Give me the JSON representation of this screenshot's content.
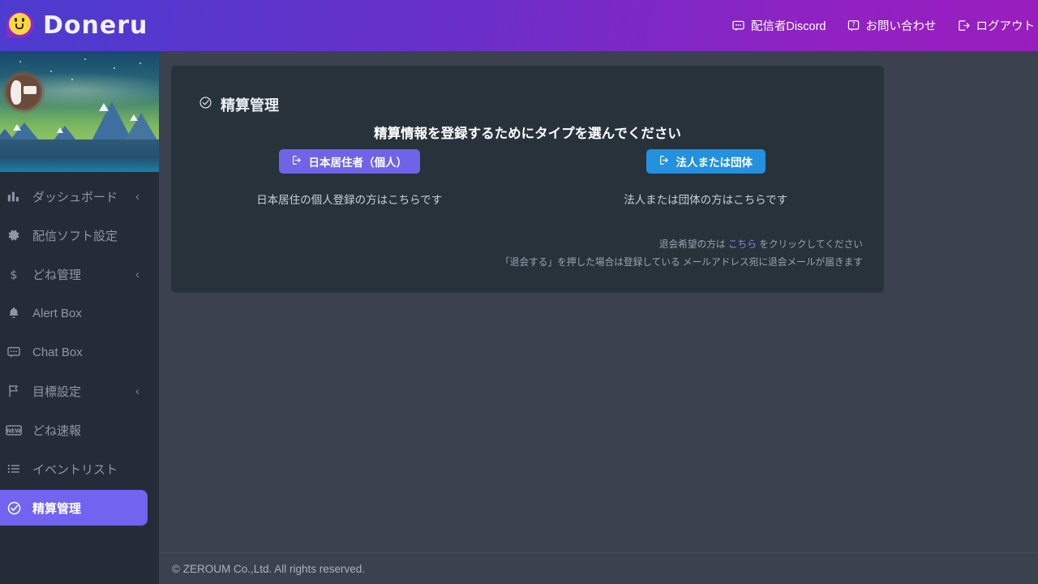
{
  "header": {
    "brand": "Doneru",
    "brand_icon": "smiley-speech-bubble-logo",
    "nav": [
      {
        "label": "配信者Discord",
        "icon": "discord-chat-icon"
      },
      {
        "label": "お問い合わせ",
        "icon": "question-message-icon"
      },
      {
        "label": "ログアウト",
        "icon": "logout-icon"
      }
    ]
  },
  "sidebar": {
    "banner_alt": "mountain-landscape-banner",
    "avatar_alt": "user-avatar",
    "items": [
      {
        "label": "ダッシュボード",
        "icon": "bar-chart-icon",
        "chevron": "‹",
        "active": false
      },
      {
        "label": "配信ソフト設定",
        "icon": "gear-icon",
        "chevron": "",
        "active": false
      },
      {
        "label": "どね管理",
        "icon": "dollar-icon",
        "chevron": "‹",
        "active": false
      },
      {
        "label": "Alert Box",
        "icon": "bell-icon",
        "chevron": "",
        "active": false
      },
      {
        "label": "Chat Box",
        "icon": "chat-bubble-icon",
        "chevron": "",
        "active": false
      },
      {
        "label": "目標設定",
        "icon": "flag-icon",
        "chevron": "‹",
        "active": false
      },
      {
        "label": "どね速報",
        "icon": "new-badge-icon",
        "chevron": "",
        "active": false
      },
      {
        "label": "イベントリスト",
        "icon": "list-icon",
        "chevron": "",
        "active": false
      },
      {
        "label": "精算管理",
        "icon": "check-circle-icon",
        "chevron": "",
        "active": true
      }
    ]
  },
  "card": {
    "title": "精算管理",
    "title_icon": "check-circle-icon",
    "heading": "精算情報を登録するためにタイプを選んでください",
    "choices": [
      {
        "button_label": "日本居住者（個人）",
        "button_icon": "login-arrow-icon",
        "description": "日本居住の個人登録の方はこちらです"
      },
      {
        "button_label": "法人または団体",
        "button_icon": "login-arrow-icon",
        "description": "法人または団体の方はこちらです"
      }
    ],
    "withdrawal": {
      "line1_before": "退会希望の方は ",
      "link": "こちら",
      "line1_after": " をクリックしてください",
      "line2": "「退会する」を押した場合は登録している メールアドレス宛に退会メールが届きます"
    }
  },
  "footer": {
    "copyright": "© ZEROUM Co.,Ltd. All rights reserved."
  },
  "colors": {
    "header_gradient_start": "#4b3ccf",
    "header_gradient_end": "#9a1dbe",
    "sidebar_bg": "#252c37",
    "active_item": "#7263f0",
    "main_bg": "#3b414f",
    "card_bg": "#27323b",
    "button_purple": "#6f63e8",
    "button_blue": "#2390e0",
    "link": "#8c86ee"
  }
}
